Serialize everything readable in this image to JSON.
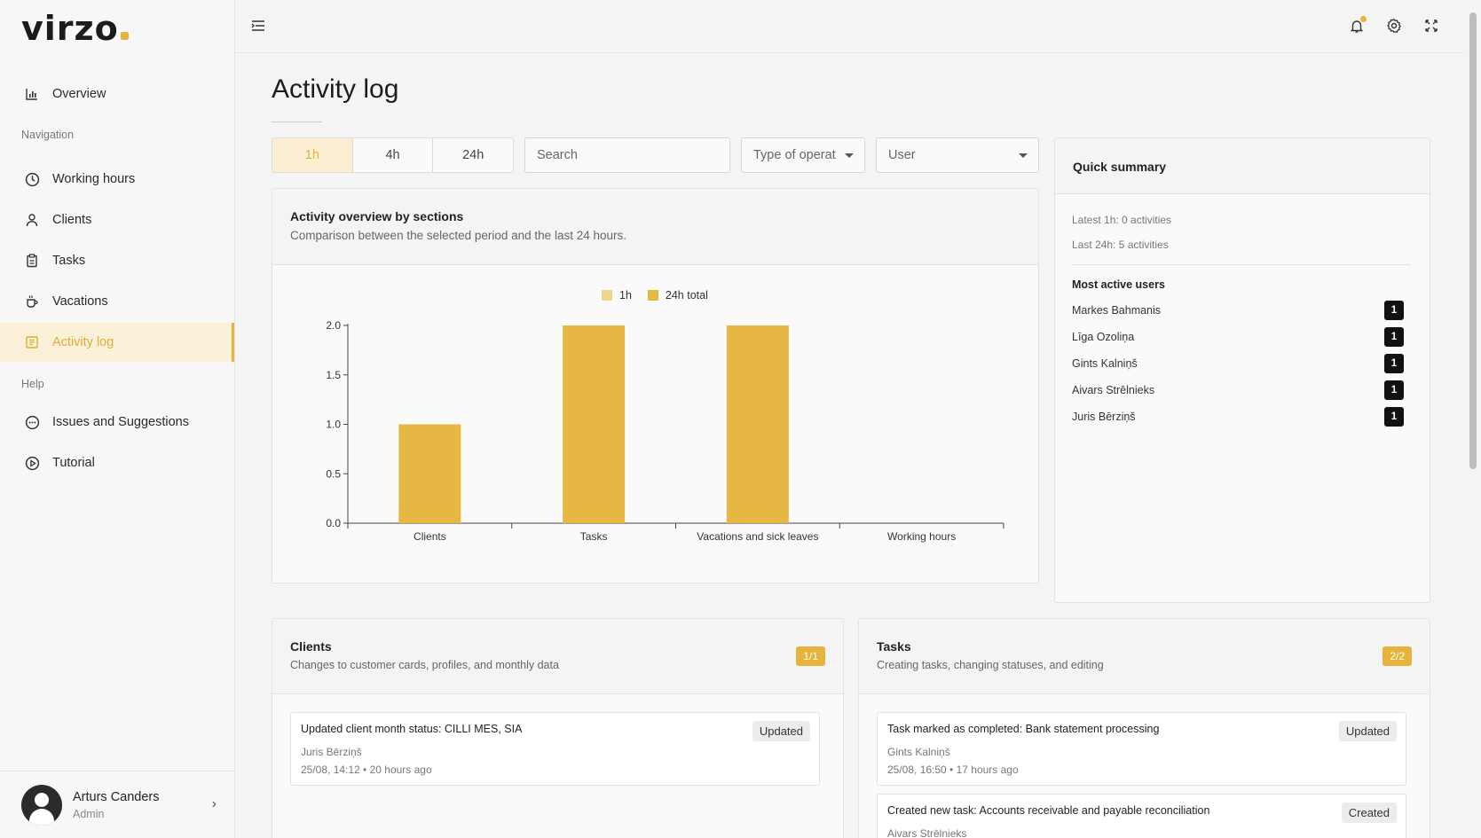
{
  "app": {
    "logo": "virzo"
  },
  "sidebar": {
    "overview": "Overview",
    "section_navigation": "Navigation",
    "items": [
      {
        "label": "Working hours",
        "icon": "clock-icon"
      },
      {
        "label": "Clients",
        "icon": "user-icon"
      },
      {
        "label": "Tasks",
        "icon": "clipboard-icon"
      },
      {
        "label": "Vacations",
        "icon": "coffee-icon"
      },
      {
        "label": "Activity log",
        "icon": "log-icon",
        "active": true
      }
    ],
    "section_help": "Help",
    "help_items": [
      {
        "label": "Issues and Suggestions",
        "icon": "chat-icon"
      },
      {
        "label": "Tutorial",
        "icon": "play-icon"
      }
    ],
    "user": {
      "name": "Arturs Canders",
      "role": "Admin"
    }
  },
  "page": {
    "title": "Activity log",
    "periods": [
      "1h",
      "4h",
      "24h"
    ],
    "active_period": "1h",
    "search_placeholder": "Search",
    "type_filter": "Type of operat",
    "user_filter": "User"
  },
  "overview_card": {
    "title": "Activity overview by sections",
    "subtitle": "Comparison between the selected period and the last 24 hours."
  },
  "chart_data": {
    "type": "bar",
    "categories": [
      "Clients",
      "Tasks",
      "Vacations and sick leaves",
      "Working hours"
    ],
    "series": [
      {
        "name": "1h",
        "values": [
          0,
          0,
          0,
          0
        ],
        "color": "#f0d58f"
      },
      {
        "name": "24h total",
        "values": [
          1,
          2,
          2,
          0
        ],
        "color": "#e6b843"
      }
    ],
    "yticks": [
      "0.0",
      "0.5",
      "1.0",
      "1.5",
      "2.0"
    ],
    "ylim": [
      0,
      2
    ],
    "legend": "top"
  },
  "summary": {
    "title": "Quick summary",
    "latest_1h": "Latest 1h: 0 activities",
    "last_24h": "Last 24h: 5 activities",
    "most_active_title": "Most active users",
    "users": [
      {
        "name": "Markes Bahmanis",
        "count": "1"
      },
      {
        "name": "Līga Ozoliņa",
        "count": "1"
      },
      {
        "name": "Gints Kalniņš",
        "count": "1"
      },
      {
        "name": "Aivars Strēlnieks",
        "count": "1"
      },
      {
        "name": "Juris Bērziņš",
        "count": "1"
      }
    ]
  },
  "clients_card": {
    "title": "Clients",
    "subtitle": "Changes to customer cards, profiles, and monthly data",
    "badge": "1/1",
    "entries": [
      {
        "title": "Updated client month status: CILLI MES, SIA",
        "user": "Juris Bērziņš",
        "time": "25/08, 14:12 • 20 hours ago",
        "tag": "Updated"
      }
    ]
  },
  "tasks_card": {
    "title": "Tasks",
    "subtitle": "Creating tasks, changing statuses, and editing",
    "badge": "2/2",
    "entries": [
      {
        "title": "Task marked as completed: Bank statement processing",
        "user": "Gints Kalniņš",
        "time": "25/08, 16:50 • 17 hours ago",
        "tag": "Updated"
      },
      {
        "title": "Created new task: Accounts receivable and payable reconciliation",
        "user": "Aivars Strēlnieks",
        "tag": "Created"
      }
    ]
  },
  "colors": {
    "accent": "#e6b43c",
    "active_bg": "#fbf1d9"
  }
}
